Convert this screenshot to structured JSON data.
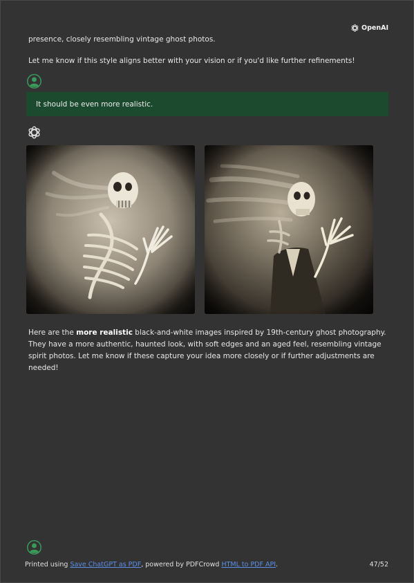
{
  "brand": {
    "name": "OpenAI"
  },
  "content": {
    "line1": "presence, closely resembling vintage ghost photos.",
    "line2": "Let me know if this style aligns better with your vision or if you'd like further refinements!",
    "user_message": "It should be even more realistic.",
    "images": [
      {
        "alt": "skeleton ghost photograph 1"
      },
      {
        "alt": "skeleton ghost photograph 2"
      }
    ],
    "para_pre": "Here are the ",
    "para_bold": "more realistic",
    "para_post": " black-and-white images inspired by 19th-century ghost photography. They have a more authentic, haunted look, with soft edges and an aged feel, resembling vintage spirit photos. Let me know if these capture your idea more closely or if further adjustments are needed!"
  },
  "footer": {
    "prefix": "Printed using ",
    "link1": "Save ChatGPT as PDF",
    "middle": ", powered by PDFCrowd ",
    "link2": "HTML to PDF API",
    "suffix": ".",
    "page": "47/52"
  },
  "colors": {
    "background": "#333333",
    "user_bubble": "#1c4a2e",
    "avatar": "#3a9a5b",
    "link": "#5b8fe8"
  }
}
